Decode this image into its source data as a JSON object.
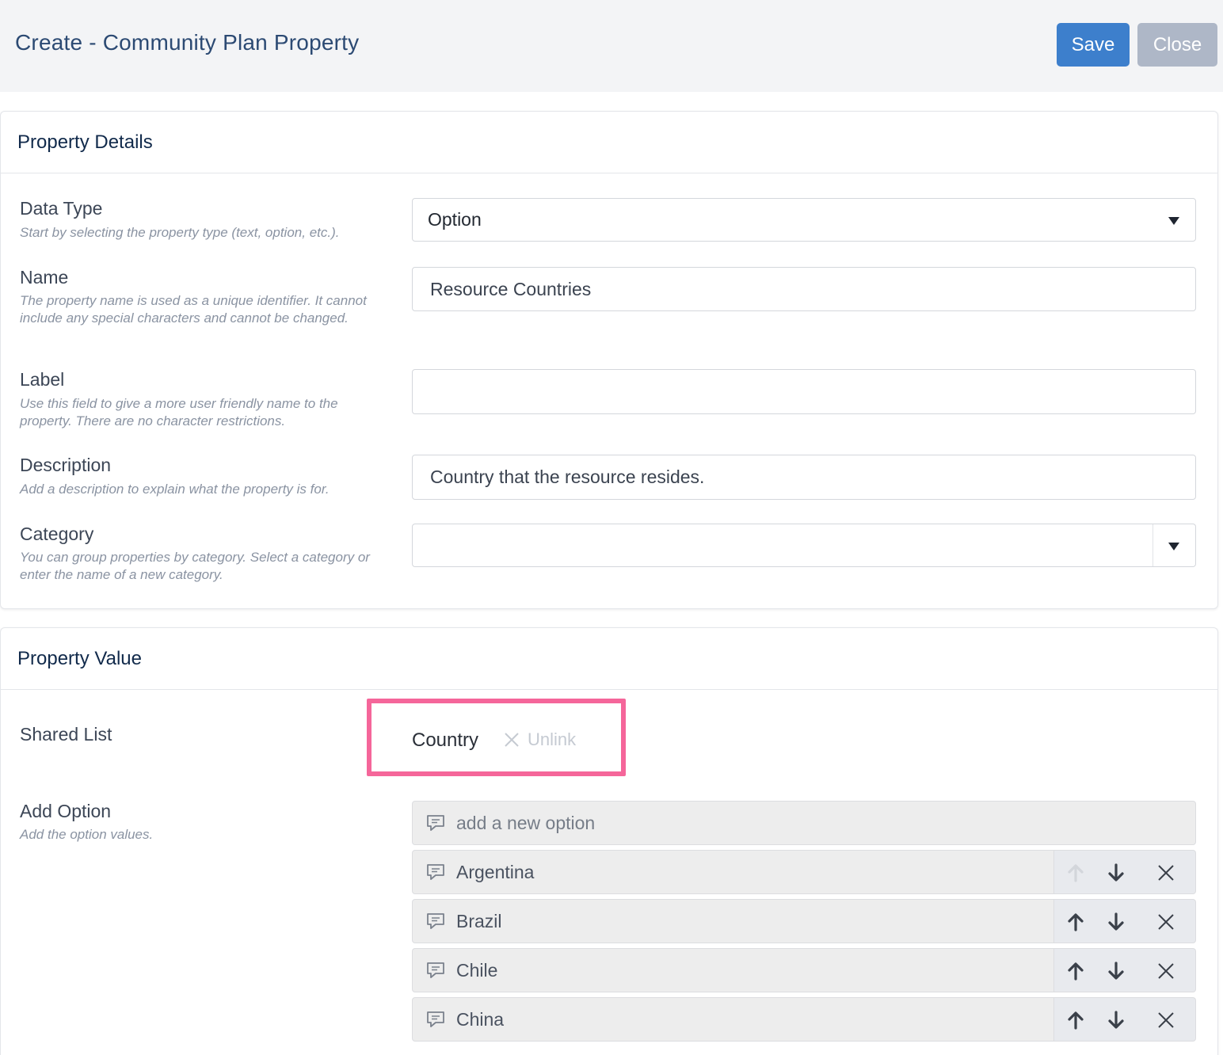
{
  "header": {
    "title": "Create - Community Plan Property",
    "save_label": "Save",
    "close_label": "Close"
  },
  "property_details": {
    "title": "Property Details",
    "data_type": {
      "label": "Data Type",
      "help": "Start by selecting the property type (text, option, etc.).",
      "value": "Option"
    },
    "name": {
      "label": "Name",
      "help": "The property name is used as a unique identifier. It cannot include any special characters and cannot be changed.",
      "value": "Resource Countries"
    },
    "label_field": {
      "label": "Label",
      "help": "Use this field to give a more user friendly name to the property. There are no character restrictions.",
      "value": ""
    },
    "description": {
      "label": "Description",
      "help": "Add a description to explain what the property is for.",
      "value": "Country that the resource resides."
    },
    "category": {
      "label": "Category",
      "help": "You can group properties by category. Select a category or enter the name of a new category.",
      "value": ""
    }
  },
  "property_value": {
    "title": "Property Value",
    "shared_list": {
      "label": "Shared List",
      "value": "Country",
      "unlink_label": "Unlink"
    },
    "add_option": {
      "label": "Add Option",
      "help": "Add the option values.",
      "placeholder": "add a new option"
    },
    "options": [
      {
        "label": "Argentina",
        "up_enabled": false
      },
      {
        "label": "Brazil",
        "up_enabled": true
      },
      {
        "label": "Chile",
        "up_enabled": true
      },
      {
        "label": "China",
        "up_enabled": true
      }
    ]
  },
  "colors": {
    "save_button": "#3d7fcc",
    "close_button": "#aeb7c7",
    "highlight_border": "#f5669a",
    "title_text": "#2c4a73"
  },
  "icons": {
    "option": "chat-bubble-icon",
    "move_up": "arrow-up-icon",
    "move_down": "arrow-down-icon",
    "remove": "close-icon",
    "unlink": "close-icon",
    "dropdown": "caret-down-icon"
  }
}
